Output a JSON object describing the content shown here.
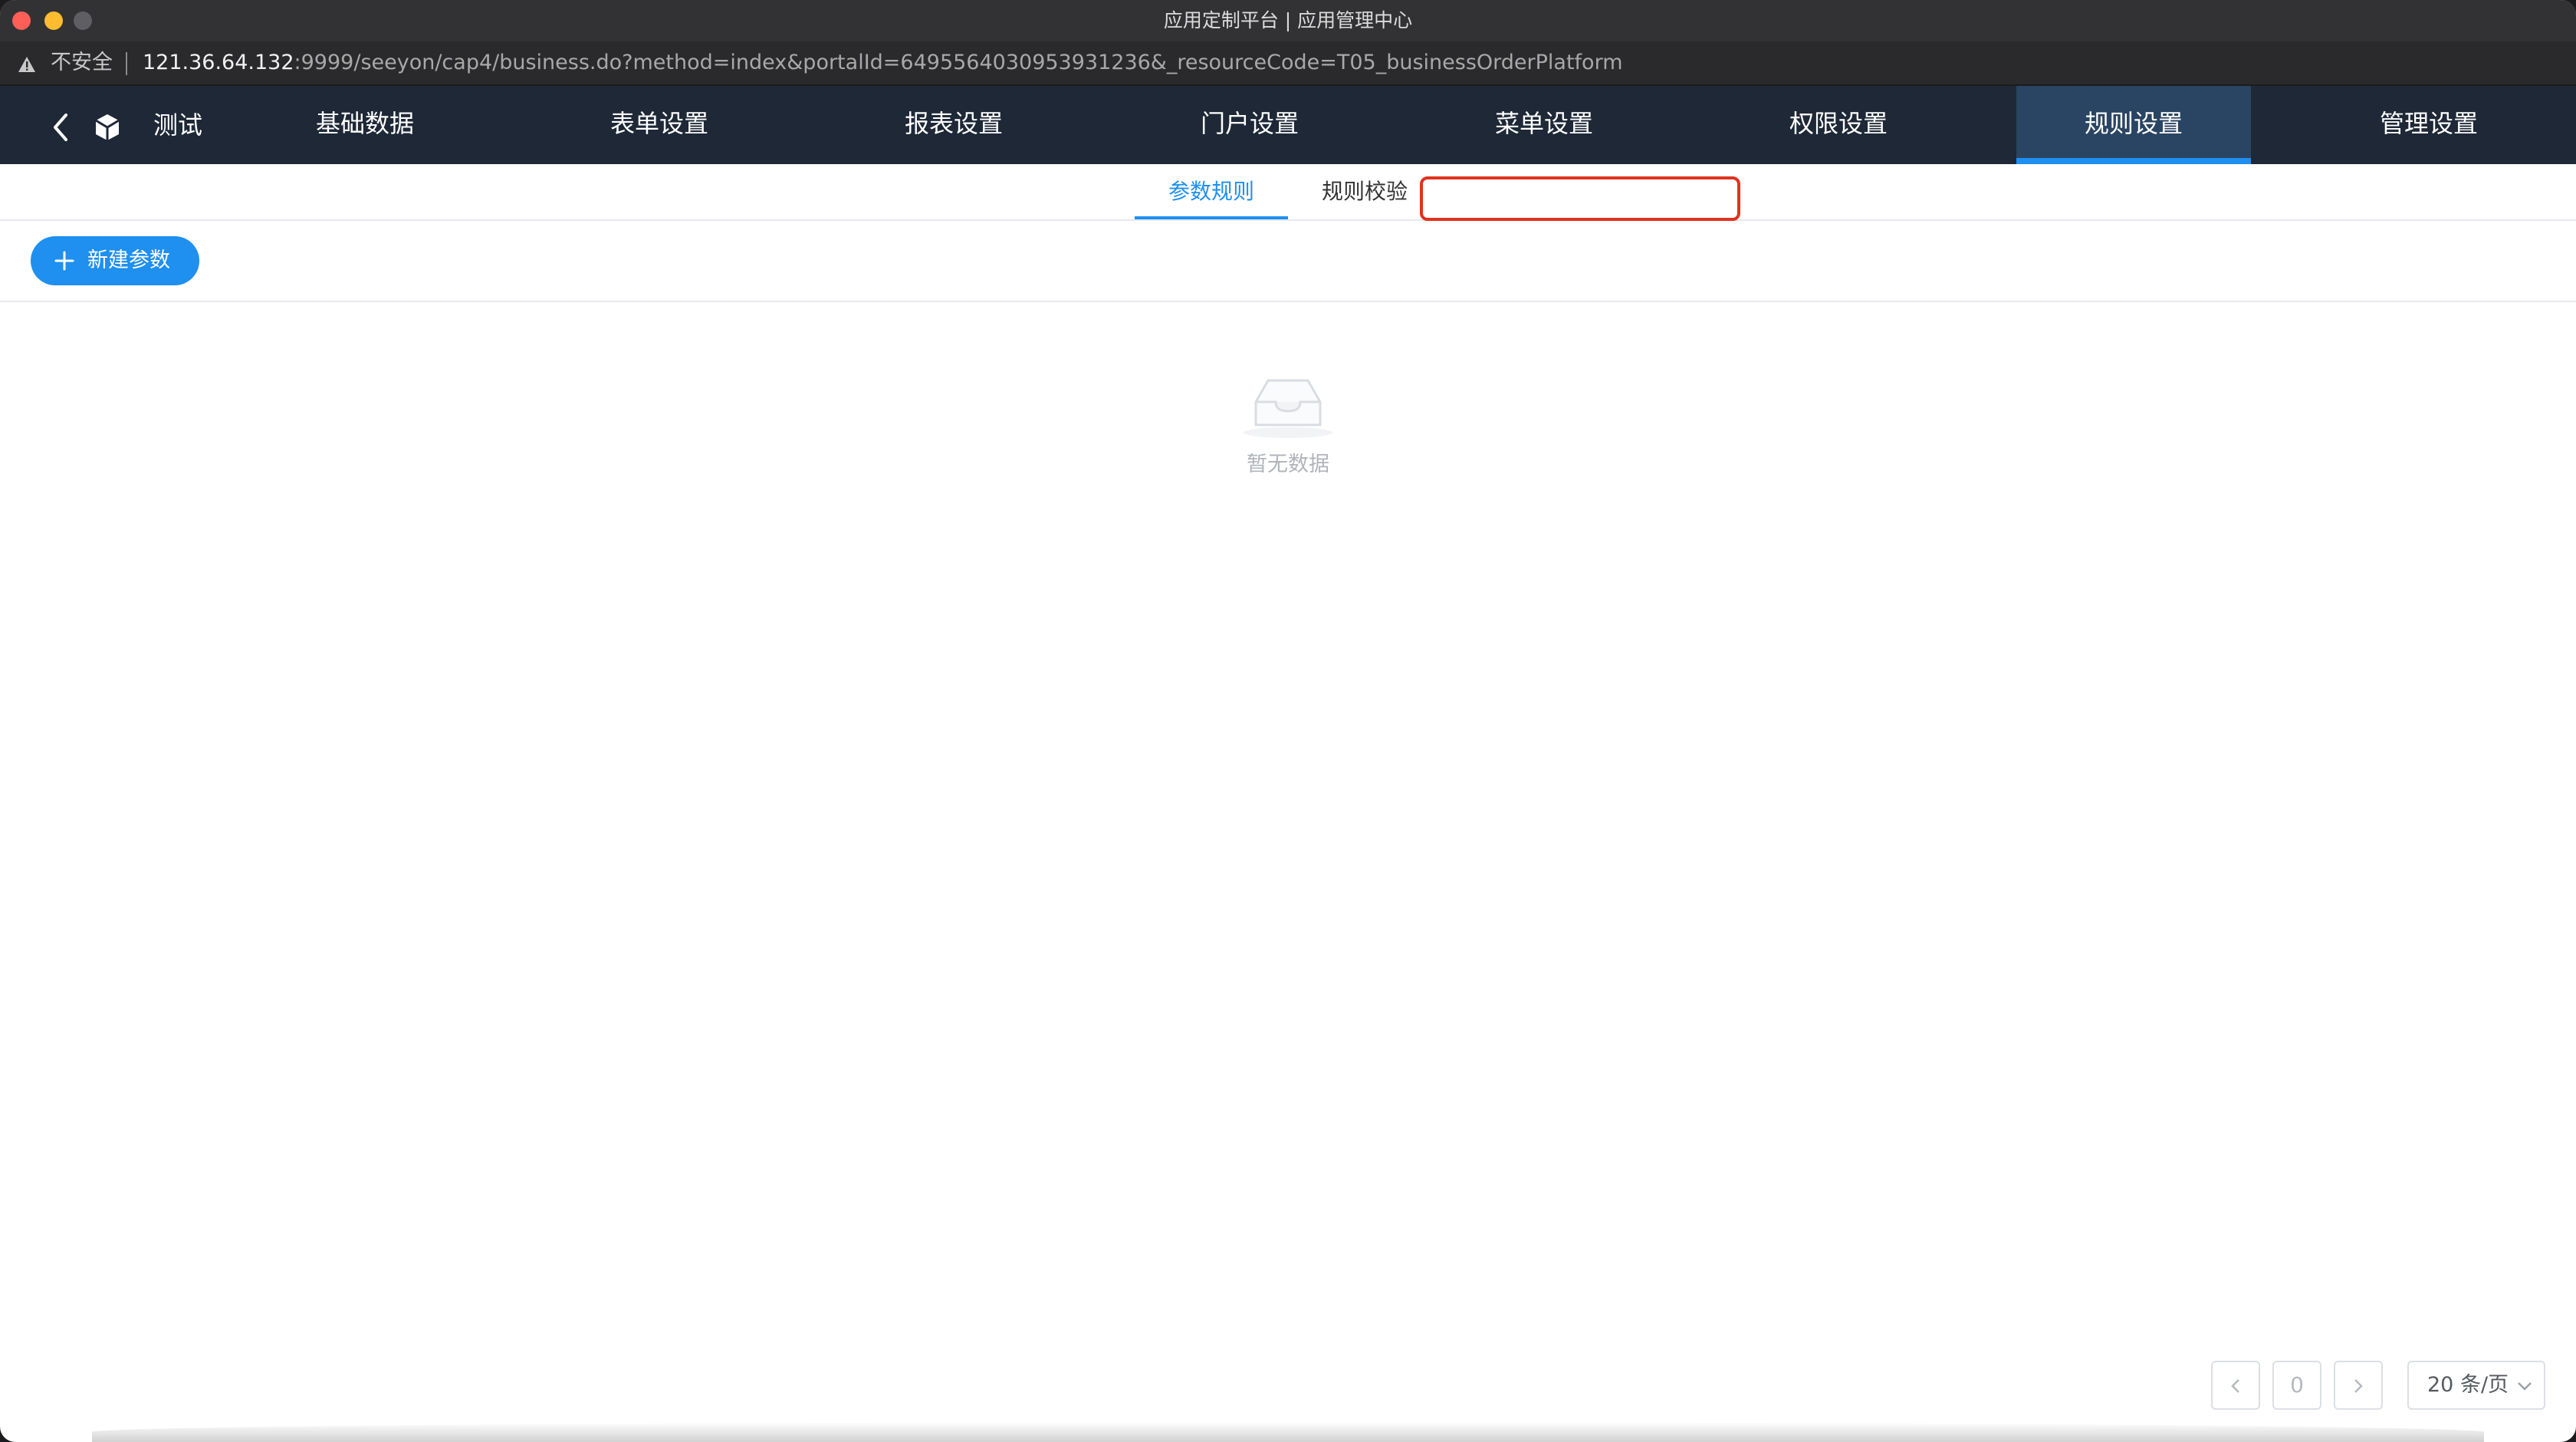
{
  "window": {
    "title": "应用定制平台 | 应用管理中心",
    "traffic_colors": {
      "close": "#ff5f57",
      "minimize": "#febc2e"
    }
  },
  "address_bar": {
    "insecure_label": "不安全",
    "url_host": "121.36.64.132",
    "url_rest": ":9999/seeyon/cap4/business.do?method=index&portalId=6495564030953931236&_resourceCode=T05_businessOrderPlatform"
  },
  "app": {
    "name": "测试",
    "nav": [
      {
        "label": "基础数据",
        "active": false
      },
      {
        "label": "表单设置",
        "active": false
      },
      {
        "label": "报表设置",
        "active": false
      },
      {
        "label": "门户设置",
        "active": false
      },
      {
        "label": "菜单设置",
        "active": false
      },
      {
        "label": "权限设置",
        "active": false
      },
      {
        "label": "规则设置",
        "active": true
      },
      {
        "label": "管理设置",
        "active": false
      }
    ]
  },
  "subtabs": [
    {
      "label": "参数规则",
      "active": true
    },
    {
      "label": "规则校验",
      "active": false
    }
  ],
  "toolbar": {
    "new_param_label": "新建参数"
  },
  "empty": {
    "text": "暂无数据"
  },
  "pagination": {
    "current_page": "0",
    "page_size_label": "20 条/页"
  },
  "colors": {
    "accent": "#1f8ff0",
    "nav_bg": "#1e2837",
    "highlight": "#e0321f"
  }
}
